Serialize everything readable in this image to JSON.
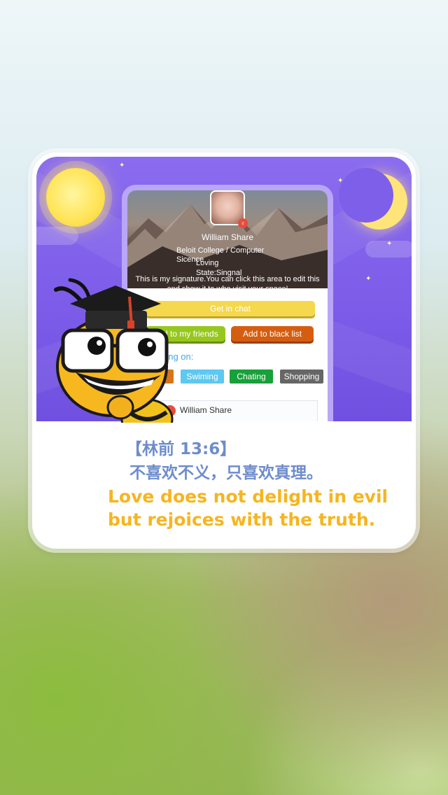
{
  "profile": {
    "name": "William Share",
    "college": "Beloit College /  Computer",
    "major": "Sicence",
    "loving": "Loving",
    "state": "State:Singnal",
    "signature": "This is my signature.You can click this area to edit this and show it to who visit your space!"
  },
  "actions": {
    "chat": "Get in chat",
    "add_friend": "Add to my friends",
    "black_list": "Add to black list"
  },
  "interests": {
    "label": "Going on:",
    "tags": [
      "",
      "Swiming",
      "Chating",
      "Shopping"
    ]
  },
  "feed": {
    "name": "William Share"
  },
  "verse": {
    "ref": "【林前 13:6】",
    "chinese": "不喜欢不义，只喜欢真理。",
    "english_1": "Love does not delight in evil",
    "english_2": "but rejoices with the truth."
  },
  "colors": {
    "verse_blue": "#6e8ccc",
    "verse_gold": "#f6b51f",
    "header_purple": "#7b5be8"
  }
}
